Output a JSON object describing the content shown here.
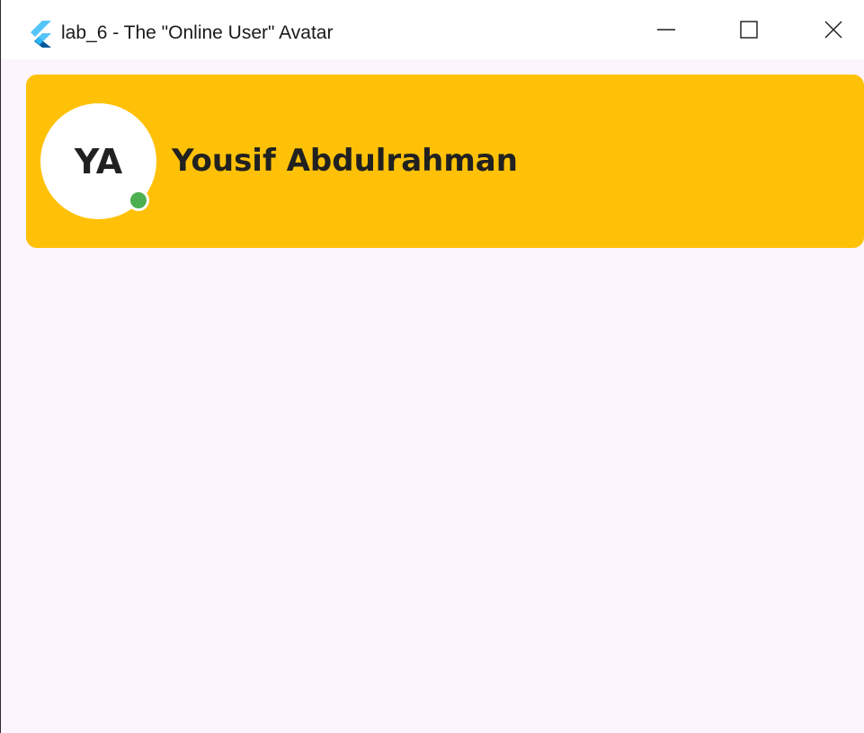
{
  "window": {
    "title": "lab_6 - The \"Online User\" Avatar",
    "app_icon": "flutter-icon",
    "controls": {
      "minimize_icon": "minimize-icon",
      "maximize_icon": "maximize-icon",
      "close_icon": "close-icon"
    }
  },
  "user_card": {
    "initials": "YA",
    "name": "Yousif Abdulrahman",
    "status": "online",
    "colors": {
      "card_background": "#ffc107",
      "avatar_background": "#ffffff",
      "status_online": "#4caf50",
      "text": "#212121",
      "page_background": "#fdf5fd"
    }
  }
}
